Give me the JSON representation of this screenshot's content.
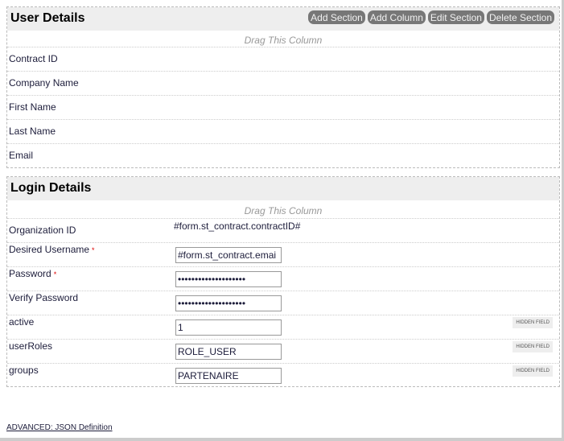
{
  "buttons": {
    "add_section": "Add Section",
    "add_column": "Add Column",
    "edit_section": "Edit Section",
    "delete_section": "Delete Section"
  },
  "drag_label": "Drag This Column",
  "sections": [
    {
      "title": "User Details",
      "fields": [
        {
          "label": "Contract ID"
        },
        {
          "label": "Company Name"
        },
        {
          "label": "First Name"
        },
        {
          "label": "Last Name"
        },
        {
          "label": "Email"
        }
      ]
    },
    {
      "title": "Login Details",
      "fields": [
        {
          "label": "Organization ID",
          "value": "#form.st_contract.contractID#"
        },
        {
          "label": "Desired Username",
          "required": "*",
          "value": "#form.st_contract.emai"
        },
        {
          "label": "Password",
          "required": "*",
          "value": "••••••••••••••••••••"
        },
        {
          "label": "Verify Password",
          "value": "••••••••••••••••••••"
        },
        {
          "label": "active",
          "value": "1",
          "badge": "HIDDEN FIELD"
        },
        {
          "label": "userRoles",
          "value": "ROLE_USER",
          "badge": "HIDDEN FIELD"
        },
        {
          "label": "groups",
          "value": "PARTENAIRE",
          "badge": "HIDDEN FIELD"
        }
      ]
    }
  ],
  "footer_link": "ADVANCED: JSON Definition"
}
